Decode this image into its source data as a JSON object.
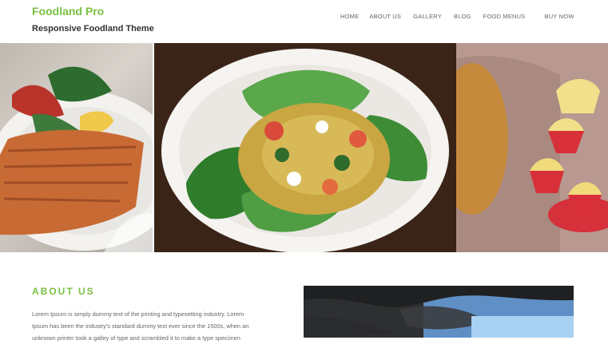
{
  "brand": {
    "title": "Foodland Pro",
    "tagline": "Responsive Foodland Theme"
  },
  "nav": {
    "items": [
      {
        "label": "HOME"
      },
      {
        "label": "ABOUT US"
      },
      {
        "label": "GALLERY"
      },
      {
        "label": "BLOG"
      },
      {
        "label": "FOOD MENUS"
      },
      {
        "label": "BUY NOW"
      }
    ]
  },
  "colors": {
    "accent": "#7ac142",
    "text_dark": "#333333",
    "text_muted": "#666666"
  },
  "banner": {
    "images": [
      {
        "name": "salmon-plate-image"
      },
      {
        "name": "salad-plate-image"
      },
      {
        "name": "cupcakes-image"
      }
    ]
  },
  "about": {
    "title": "ABOUT US",
    "lines": [
      "Lorem Ipsum is simply dummy text of the printing and typesetting industry. Lorem",
      "Ipsum has been the industry's standard dummy text ever since the 1500s, when an",
      "unknown printer took a galley of type and scrambled it to make a type specimen"
    ]
  }
}
